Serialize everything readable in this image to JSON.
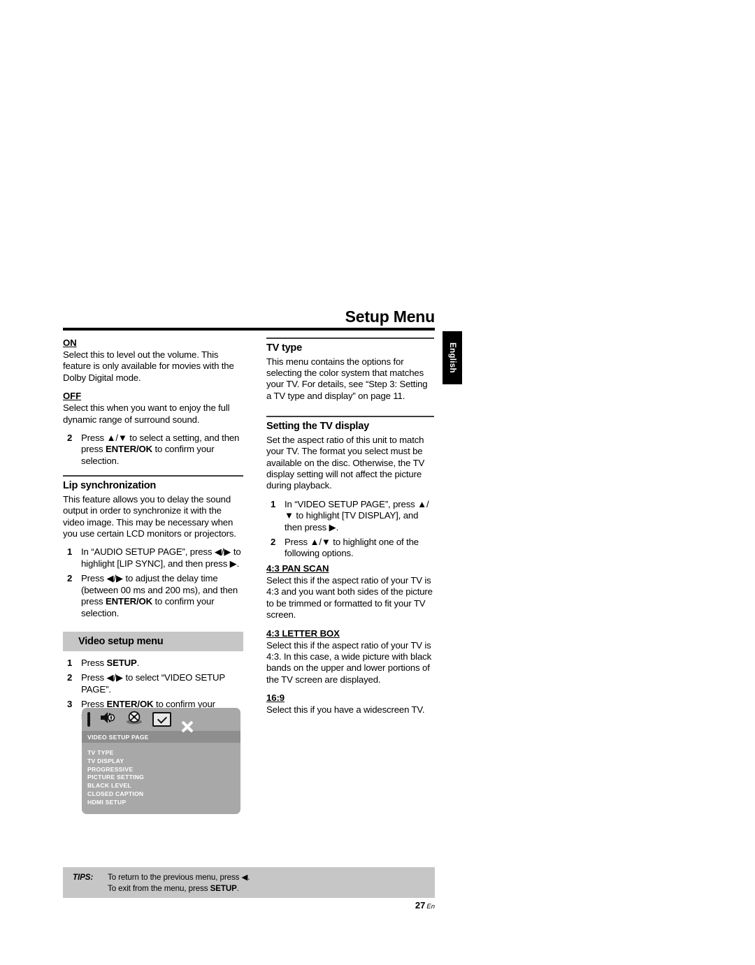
{
  "header": {
    "title": "Setup Menu",
    "language_tab": "English"
  },
  "left_column": {
    "on": {
      "label": "ON",
      "body": "Select this to level out the volume. This feature is only available for movies with the Dolby Digital mode."
    },
    "off": {
      "label": "OFF",
      "body": "Select this when you want to enjoy the full dynamic range of surround sound."
    },
    "step_confirm": {
      "num": "2",
      "text_a": "Press ▲/▼ to select a setting, and then press ",
      "bold": "ENTER/OK",
      "text_b": " to confirm your selection."
    },
    "lip_sync": {
      "heading": "Lip synchronization",
      "body": "This feature allows you to delay the sound output in order to synchronize it with the video image. This may be necessary when you use certain LCD monitors or projectors.",
      "step1": {
        "num": "1",
        "text": "In “AUDIO SETUP PAGE”, press ◀/▶ to highlight [LIP SYNC], and then press ▶."
      },
      "step2": {
        "num": "2",
        "text_a": "Press ◀/▶ to adjust the delay time (between 00 ms and 200 ms), and then press ",
        "bold": "ENTER/OK",
        "text_b": " to confirm your selection."
      }
    },
    "video_setup_menu": {
      "heading": "Video setup menu",
      "step1": {
        "num": "1",
        "text_a": "Press ",
        "bold": "SETUP",
        "text_b": "."
      },
      "step2": {
        "num": "2",
        "text": "Press ◀/▶ to select “VIDEO SETUP PAGE”."
      },
      "step3": {
        "num": "3",
        "text_a": "Press ",
        "bold": "ENTER/OK",
        "text_b": " to confirm your selection."
      }
    }
  },
  "osd": {
    "icons": [
      "tv-icon",
      "audio-icon",
      "disc-icon",
      "preferences-icon",
      "close-icon"
    ],
    "title": "VIDEO SETUP PAGE",
    "items": [
      "TV TYPE",
      "TV DISPLAY",
      "PROGRESSIVE",
      "PICTURE SETTING",
      "BLACK LEVEL",
      "CLOSED CAPTION",
      "HDMI SETUP"
    ]
  },
  "right_column": {
    "tv_type": {
      "heading": "TV type",
      "body": "This menu contains the options for selecting the color system that matches your TV. For details, see “Step 3: Setting a TV type and display” on page 11."
    },
    "tv_display": {
      "heading": "Setting the TV display",
      "body": "Set the aspect ratio of this unit to match your TV. The format you select must be available on the disc. Otherwise, the TV display setting will not affect the picture during playback.",
      "step1": {
        "num": "1",
        "text": "In “VIDEO SETUP PAGE”, press ▲/▼ to highlight [TV DISPLAY], and then press ▶."
      },
      "step2": {
        "num": "2",
        "text": "Press ▲/▼ to highlight one of the following options."
      },
      "pan_scan": {
        "label": "4:3 PAN SCAN",
        "body": "Select this if the aspect ratio of your TV is 4:3 and you want both sides of the picture to be trimmed or formatted to fit your TV screen."
      },
      "letter_box": {
        "label": "4:3 LETTER BOX",
        "body": "Select this if the aspect ratio of your TV is 4:3. In this case, a wide picture with black bands on the upper and lower portions of the TV screen are displayed."
      },
      "wide": {
        "label": "16:9",
        "body": "Select this if you have a widescreen TV."
      }
    }
  },
  "tips": {
    "label": "TIPS:",
    "line1": "To return to the previous menu, press ◀.",
    "line2_a": "To exit from the menu, press ",
    "line2_bold": "SETUP",
    "line2_b": "."
  },
  "folio": {
    "page_number": "27",
    "lang": "En"
  },
  "colors": {
    "band_gray": "#c6c6c6",
    "osd_bg": "#a8a8a8",
    "osd_title_bg": "#8e8e8e",
    "rule_black": "#000000"
  }
}
